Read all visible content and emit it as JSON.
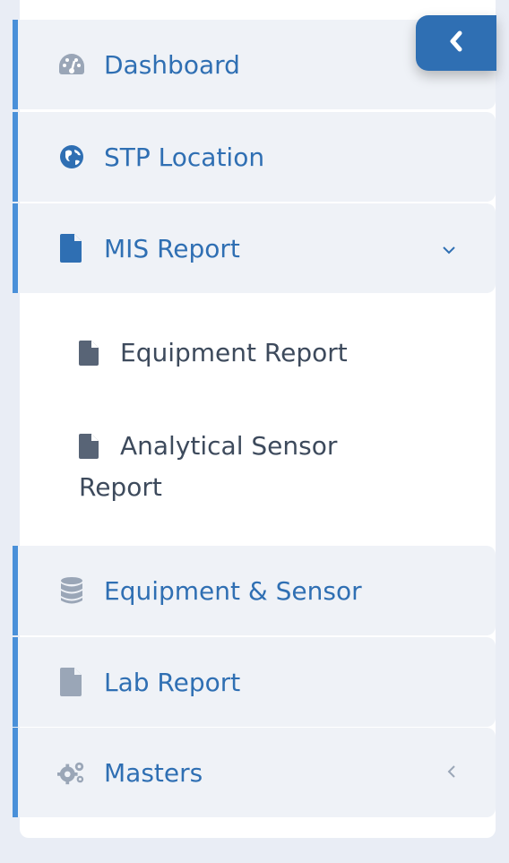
{
  "menu": {
    "items": [
      {
        "label": "Dashboard",
        "icon": "dashboard-gauge-icon"
      },
      {
        "label": "STP Location",
        "icon": "globe-icon"
      },
      {
        "label": "MIS Report",
        "icon": "file-icon",
        "caret": "⌄"
      },
      {
        "label": "Equipment & Sensor",
        "icon": "database-icon"
      },
      {
        "label": "Lab Report",
        "icon": "file-icon"
      },
      {
        "label": "Masters",
        "icon": "cogs-icon",
        "caret": "‹"
      }
    ],
    "submenu": {
      "equipment_report": "Equipment Report",
      "analytical_line1": "Analytical Sensor",
      "analytical_line2": "Report"
    }
  },
  "colors": {
    "accent": "#2f6fb3",
    "item_bg": "#eff2f7",
    "border": "#4a90d9",
    "page_bg": "#e9edf5"
  },
  "toggle": {
    "icon": "chevron-left-icon"
  }
}
